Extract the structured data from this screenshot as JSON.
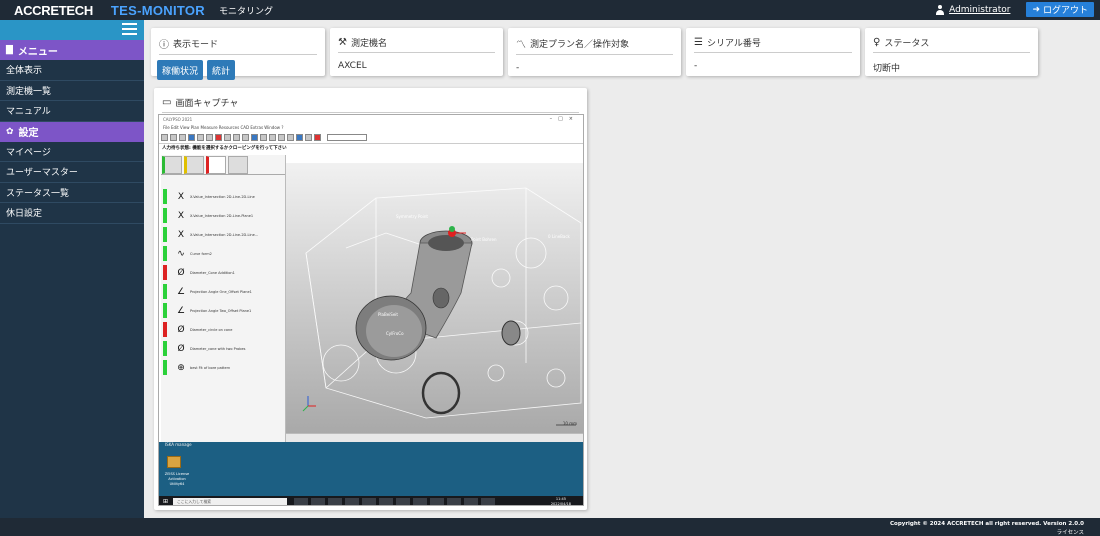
{
  "header": {
    "brand": "ACCRETECH",
    "product": "TES-MONITOR",
    "subtitle": "モニタリング",
    "user": "Administrator",
    "logout_label": "ログアウト"
  },
  "sidebar": {
    "sections": [
      {
        "title": "メニュー",
        "icon": "file-icon",
        "items": [
          "全体表示",
          "測定機一覧",
          "マニュアル"
        ]
      },
      {
        "title": "設定",
        "icon": "gear-icon",
        "items": [
          "マイページ",
          "ユーザーマスター",
          "ステータス一覧",
          "休日設定"
        ]
      }
    ]
  },
  "cards": {
    "display_mode": {
      "title": "表示モード",
      "buttons": [
        "稼働状況",
        "統計"
      ]
    },
    "machine_name": {
      "title": "測定機名",
      "value": "AXCEL"
    },
    "plan": {
      "title": "測定プラン名／操作対象",
      "value": "-"
    },
    "serial": {
      "title": "シリアル番号",
      "value": "-"
    },
    "status": {
      "title": "ステータス",
      "value": "切断中"
    }
  },
  "capture": {
    "title": "画面キャプチャ",
    "app_status": "人力待ち状態: 機能を選択するかクローピングを行って下さい",
    "elements": [
      {
        "sym": "X",
        "label": "X-Value_Intersection 2D-Line-2D-Line",
        "ok": true
      },
      {
        "sym": "X",
        "label": "X-Value_Intersection 2D-Line-Plane1",
        "ok": true
      },
      {
        "sym": "X",
        "label": "X-Value_Intersection 2D-Line-2D-Line...",
        "ok": true
      },
      {
        "sym": "∿",
        "label": "Curve form2",
        "ok": true
      },
      {
        "sym": "Ø",
        "label": "Diameter_Cone Addition1",
        "ok": false
      },
      {
        "sym": "∠",
        "label": "Projection Angle One_Offset Plane1",
        "ok": true
      },
      {
        "sym": "∠",
        "label": "Projection Angle Two_Offset Plane1",
        "ok": true
      },
      {
        "sym": "Ø",
        "label": "Diameter_circle on cone",
        "ok": false
      },
      {
        "sym": "Ø",
        "label": "Diameter_cone with two Probes",
        "ok": true
      },
      {
        "sym": "⊕",
        "label": "best Fit of bore pattern",
        "ok": true
      }
    ],
    "cnc_button": "CNCスタート",
    "scale": "10 mm",
    "desktop_label": "ISKA manage",
    "desktop_icon_caption": "ZEISS License Activation Utility64",
    "search_placeholder": "ここに入力して検索",
    "clock_time": "11:45",
    "clock_date": "2022/04/18"
  },
  "footer": {
    "copyright": "Copyright © 2024 ACCRETECH all right reserved. Version 2.0.0",
    "license": "ライセンス"
  }
}
